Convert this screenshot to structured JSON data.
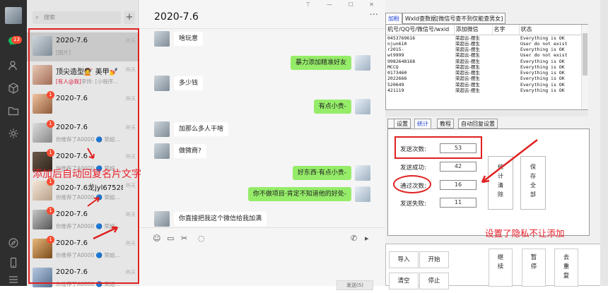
{
  "sidebar": {
    "chat_badge": "13",
    "icons": [
      "chat-icon",
      "contacts-icon",
      "box-icon",
      "folder-icon",
      "gear-icon",
      "compass-icon",
      "phone-icon",
      "menu-icon"
    ]
  },
  "conversations": {
    "search_placeholder": "搜索",
    "add_label": "+",
    "items": [
      {
        "name": "2020-7.6",
        "time": "昨天",
        "preview": "[图片]",
        "badge": "",
        "selected": true
      },
      {
        "name": "顶尖造型💇 美甲💅",
        "time": "昨天",
        "preview_red": "[有人@我]",
        "preview": "李烨: [小程序...",
        "badge": ""
      },
      {
        "name": "2020-7.6",
        "time": "昨天",
        "preview": "",
        "badge": "1"
      },
      {
        "name": "2020-7.6",
        "time": "昨天",
        "preview": "你推荐了A0000 🔵 荣超...",
        "badge": "1"
      },
      {
        "name": "2020-7.6",
        "time": "昨天",
        "preview": "你推荐了A0000 🔵 荣超...",
        "badge": "1"
      },
      {
        "name": "2020-7.6龙jyl675283...",
        "time": "昨天",
        "preview": "你推荐了A0000 🔵 荣超...",
        "badge": "1"
      },
      {
        "name": "2020-7.6",
        "time": "昨天",
        "preview": "你推荐了A0000 🔵 荣超...",
        "badge": "1"
      },
      {
        "name": "2020-7.6",
        "time": "昨天",
        "preview": "你推荐了A0000 🔵 荣超...",
        "badge": "1"
      },
      {
        "name": "2020-7.6",
        "time": "昨天",
        "preview": "你推荐了A0000 🔵 荣超...",
        "badge": ""
      }
    ],
    "annotation": "添加后自动回复名片文字"
  },
  "chat": {
    "title": "2020-7.6",
    "more": "···",
    "window_controls": "⊤ — ☐ ✕",
    "messages": [
      {
        "dir": "in",
        "text": "啥玩意"
      },
      {
        "dir": "out",
        "text": "暴力添加精准好友"
      },
      {
        "dir": "in",
        "text": "多少钱"
      },
      {
        "dir": "out",
        "text": "有点小贵-"
      },
      {
        "dir": "in",
        "text": "加那么多人干啥"
      },
      {
        "dir": "in",
        "text": "做微商?"
      },
      {
        "dir": "out",
        "text": "好东西·有点小贵-"
      },
      {
        "dir": "out",
        "text": "你不做项目·肯定不知道他的好处-"
      },
      {
        "dir": "in",
        "text": "你直接把我这个微信给我加满"
      }
    ],
    "send_label": "发送(S)"
  },
  "tool": {
    "tabs": [
      "加粉",
      "WxId查数据[微信号查不到仅能查男女]"
    ],
    "grid": {
      "headers": [
        "机号/QQ号/微信号/wxid",
        "添加微信",
        "名字",
        "状态"
      ],
      "rows": [
        [
          "0453769616",
          "荣超云-摆生",
          "",
          "Everything is OK"
        ],
        [
          "njun610",
          "荣超云-摆生",
          "",
          "User do not exist"
        ],
        [
          "r2015-",
          "荣超云-摆生",
          "",
          "Everything is OK"
        ],
        [
          "wt9999",
          "荣超云-摆生",
          "",
          "User do not exist"
        ],
        [
          "9982648168",
          "荣超云-摆生",
          "",
          "Everything is OK"
        ],
        [
          "MCCQ",
          "荣超云-摆生",
          "",
          "Everything is OK"
        ],
        [
          "0173460",
          "荣超云-摆生",
          "",
          "Everything is OK"
        ],
        [
          "2022666",
          "荣超云-摆生",
          "",
          "Everything is OK"
        ],
        [
          "520649",
          "荣超云-摆生",
          "",
          "Everything is OK"
        ],
        [
          "421119",
          "荣超云-摆生",
          "",
          "Everything is OK"
        ]
      ]
    },
    "subtabs": [
      "设置",
      "统计",
      "教程",
      "自动回复设置"
    ],
    "active_subtab": "统计",
    "stats": [
      {
        "label": "发送次数:",
        "value": "53"
      },
      {
        "label": "发送成功:",
        "value": "42"
      },
      {
        "label": "通过次数:",
        "value": "16"
      },
      {
        "label": "发送失败:",
        "value": "11"
      }
    ],
    "clear_stats": "统计清除",
    "save_all": "保存全部",
    "annotation": "设置了隐私不让添加",
    "controls": {
      "import": "导入",
      "start": "开始",
      "clear": "清空",
      "stop": "停止",
      "continue": "继续",
      "pause": "暂停",
      "dedupe": "去重复"
    }
  }
}
